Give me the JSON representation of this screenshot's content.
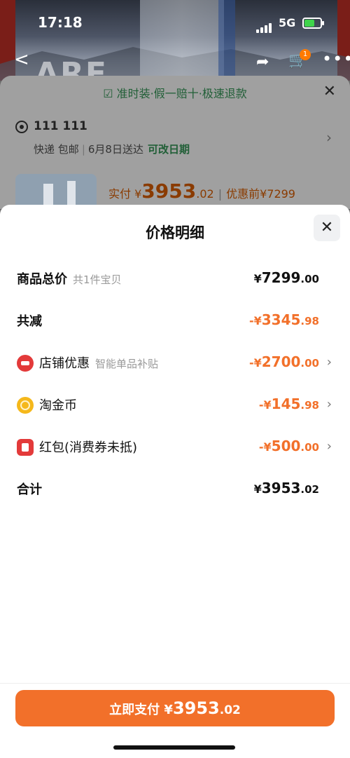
{
  "status": {
    "time": "17:18",
    "network": "5G"
  },
  "nav": {
    "back": "<",
    "share": "share-icon",
    "cart": "cart-icon",
    "cart_badge": "1",
    "more": "•••",
    "banner_text": "ARE"
  },
  "background_panel": {
    "guarantee": "准时装·假一赔十·极速退款",
    "address_name": "111 111",
    "delivery_method": "快递",
    "shipping": "包邮",
    "delivery_date": "6月8日送达",
    "change_date": "可改日期",
    "paid_label": "实付",
    "paid_currency": "¥",
    "paid_int": "3953",
    "paid_dec": ".02",
    "before_discount": "优惠前¥7299"
  },
  "sheet": {
    "title": "价格明细",
    "rows": [
      {
        "label": "商品总价",
        "sub": "共1件宝贝",
        "currency": "¥",
        "int": "7299",
        "dec": ".00"
      },
      {
        "label": "共减",
        "currency": "-¥",
        "int": "3345",
        "dec": ".98"
      },
      {
        "label": "店铺优惠",
        "sub": "智能单品补贴",
        "currency": "-¥",
        "int": "2700",
        "dec": ".00"
      },
      {
        "label": "淘金币",
        "currency": "-¥",
        "int": "145",
        "dec": ".98"
      },
      {
        "label": "红包(消费券未抵)",
        "currency": "-¥",
        "int": "500",
        "dec": ".00"
      },
      {
        "label": "合计",
        "currency": "¥",
        "int": "3953",
        "dec": ".02"
      }
    ]
  },
  "pay_button": {
    "label": "立即支付",
    "currency": "¥",
    "int": "3953",
    "dec": ".02"
  },
  "colors": {
    "accent": "#f2702a",
    "green": "#215f37"
  }
}
